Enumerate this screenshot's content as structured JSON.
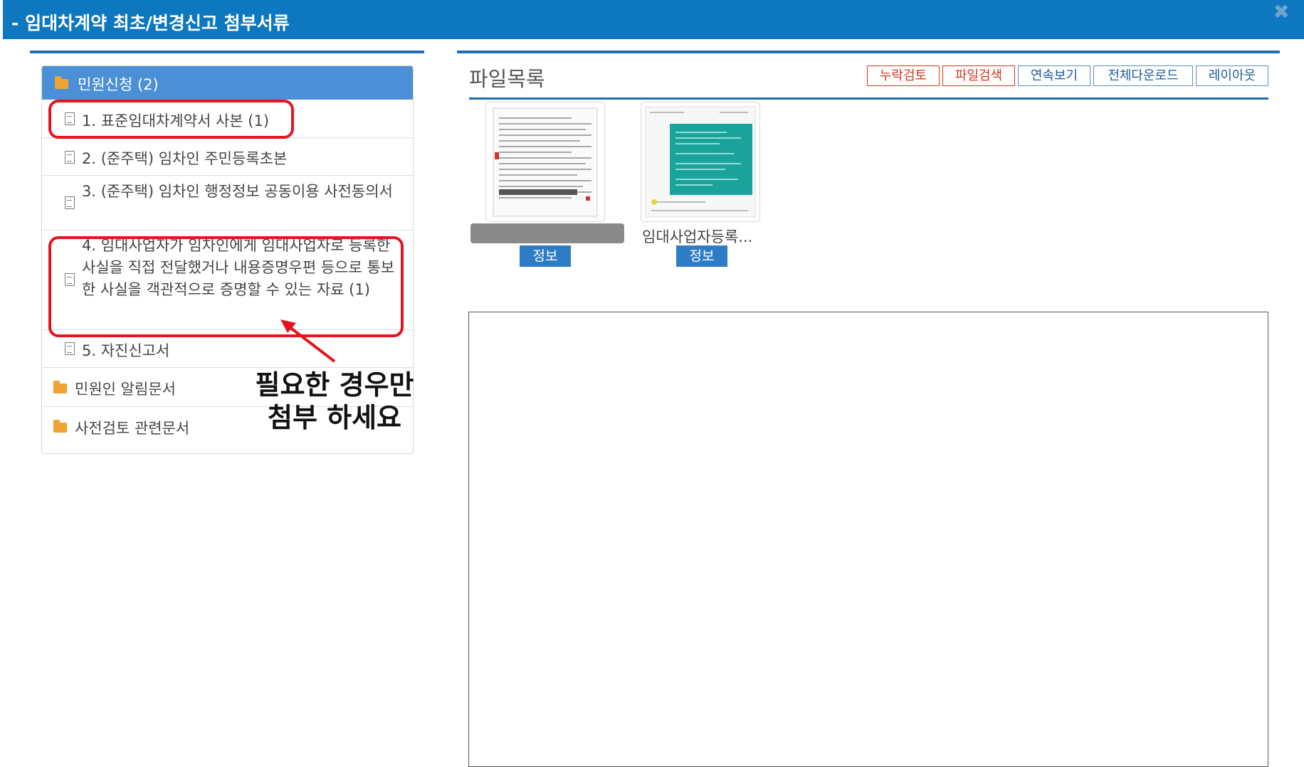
{
  "window": {
    "title": "- 임대차계약 최초/변경신고 첨부서류",
    "close_glyph": "✖"
  },
  "tree": {
    "header": {
      "label": "민원신청 (2)",
      "icon": "folder-icon"
    },
    "items": [
      {
        "label": "1. 표준임대차계약서 사본 (1)",
        "icon": "document-icon",
        "highlighted": true
      },
      {
        "label": "2. (준주택) 임차인 주민등록초본",
        "icon": "document-icon"
      },
      {
        "label": "3. (준주택) 임차인 행정정보 공동이용 사전동의서",
        "icon": "document-icon"
      },
      {
        "label": "4. 임대사업자가 임차인에게 임대사업자로 등록한 사실을 직접 전달했거나 내용증명우편 등으로 통보한 사실을 객관적으로 증명할 수 있는 자료 (1)",
        "icon": "document-icon",
        "highlighted": true
      },
      {
        "label": "5. 자진신고서",
        "icon": "document-icon"
      }
    ],
    "folders": [
      {
        "label": "민원인 알림문서",
        "icon": "folder-icon"
      },
      {
        "label": "사전검토 관련문서",
        "icon": "folder-icon"
      }
    ]
  },
  "annotation": {
    "line1": "필요한 경우만",
    "line2": "첨부 하세요",
    "color": "#e5141f"
  },
  "file_list": {
    "title": "파일목록",
    "buttons": [
      {
        "label": "누락검토",
        "style": "red"
      },
      {
        "label": "파일검색",
        "style": "red"
      },
      {
        "label": "연속보기",
        "style": "blue"
      },
      {
        "label": "전체다운로드",
        "style": "blue"
      },
      {
        "label": "레이아웃",
        "style": "blue"
      }
    ],
    "files": [
      {
        "name": "",
        "name_redacted": true,
        "info_label": "정보",
        "thumbnail": "document-thumbnail"
      },
      {
        "name": "임대사업자등록...",
        "info_label": "정보",
        "thumbnail": "registration-thumbnail"
      }
    ]
  },
  "colors": {
    "titlebar": "#0d77bf",
    "tree_header": "#4b90d6",
    "accent_line": "#1e6db5",
    "info_button": "#2e7cc6",
    "highlight": "#e5141f",
    "folder": "#f0a232"
  }
}
